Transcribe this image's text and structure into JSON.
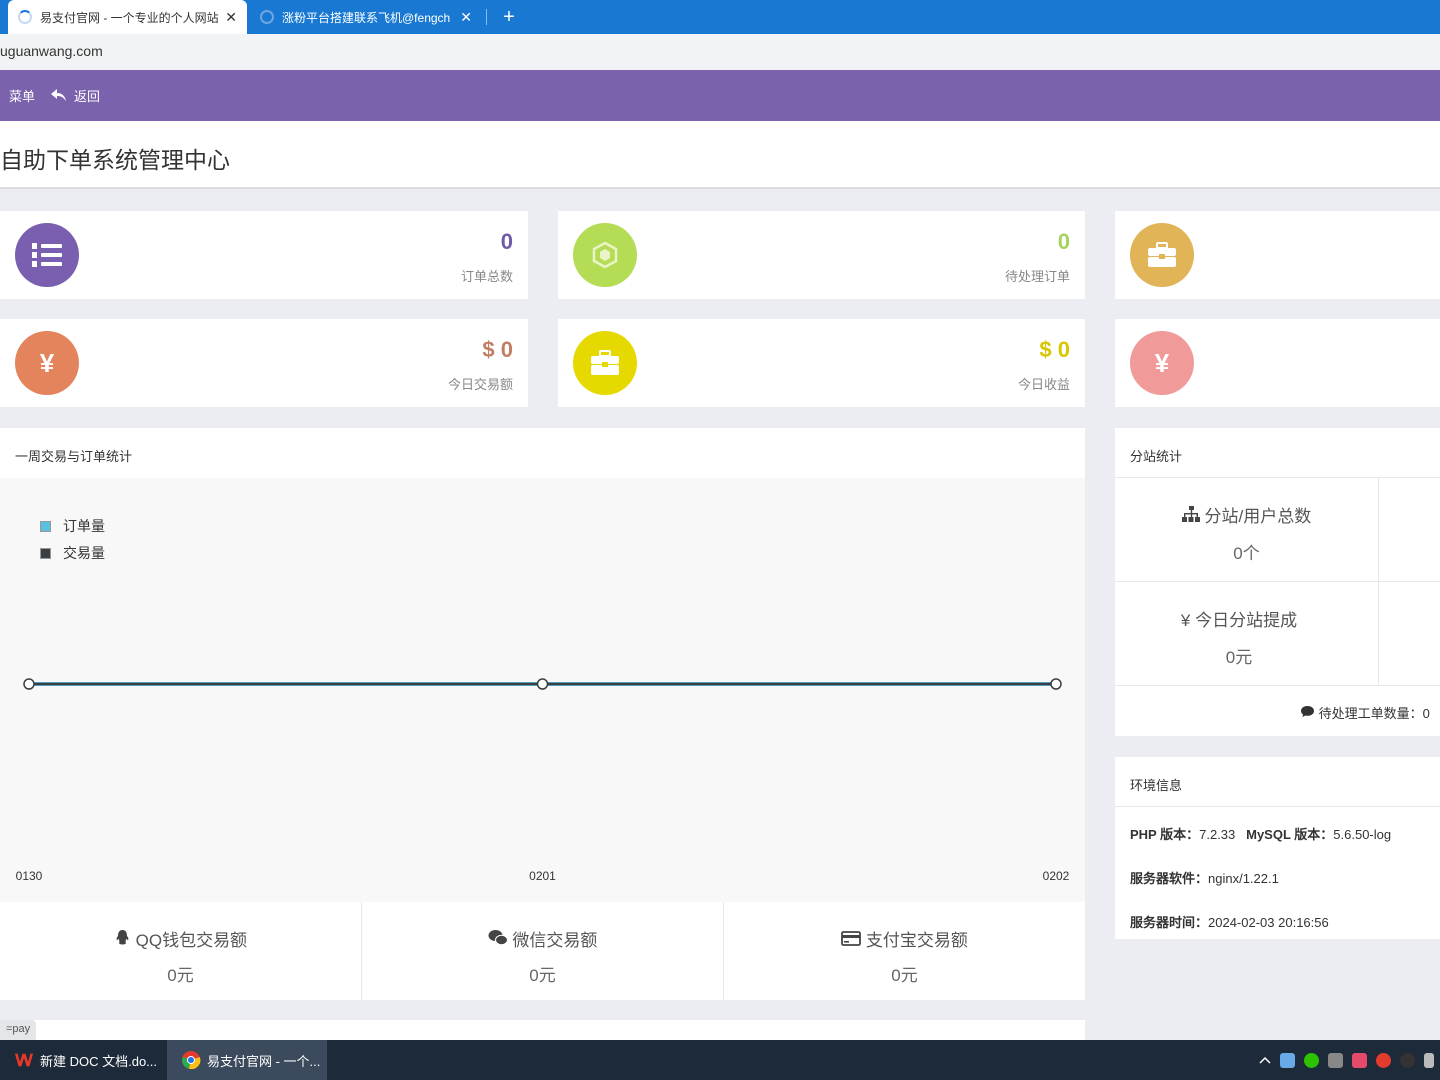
{
  "browser": {
    "tabs": [
      {
        "title": "易支付官网 - 一个专业的个人网站",
        "close": "✕"
      },
      {
        "title": "涨粉平台搭建联系飞机@fengch",
        "close": "✕"
      }
    ],
    "new_tab": "+",
    "url": "uguanwang.com"
  },
  "appbar": {
    "menu_label": "菜单",
    "back_label": "返回"
  },
  "page_title": "自助下单系统管理中心",
  "stats": [
    {
      "value": "0",
      "label": "订单总数",
      "color": "#7a5fb0",
      "value_color": "#6e5aa8"
    },
    {
      "value": "0",
      "label": "待处理订单",
      "color": "#b4dc55",
      "value_color": "#a6d25e"
    },
    {
      "value": "",
      "label": "",
      "color": "#e0b457"
    },
    {
      "value": "$ 0",
      "label": "今日交易额",
      "color": "#e4845c",
      "value_color": "#c27e64"
    },
    {
      "value": "$ 0",
      "label": "今日收益",
      "color": "#e6d900",
      "value_color": "#d8c700"
    },
    {
      "value": "",
      "label": "",
      "color": "#f09a9a"
    }
  ],
  "chart_panel": {
    "title": "一周交易与订单统计"
  },
  "chart_data": {
    "type": "line",
    "x": [
      "0130",
      "0201",
      "0202"
    ],
    "series": [
      {
        "name": "订单量",
        "values": [
          0,
          0,
          0
        ],
        "color": "#5bc0de"
      },
      {
        "name": "交易量",
        "values": [
          0,
          0,
          0
        ],
        "color": "#3a3f44"
      }
    ]
  },
  "payments": [
    {
      "title": "QQ钱包交易额",
      "value": "0元"
    },
    {
      "title": "微信交易额",
      "value": "0元"
    },
    {
      "title": "支付宝交易额",
      "value": "0元"
    }
  ],
  "substation": {
    "title": "分站统计",
    "users_title": "分站/用户总数",
    "users_value": "0个",
    "commission_title": "今日分站提成",
    "commission_value": "0元",
    "tickets_label": "待处理工单数量：0"
  },
  "env": {
    "title": "环境信息",
    "php_label": "PHP 版本：",
    "php_value": "7.2.33",
    "mysql_label": "MySQL 版本：",
    "mysql_value": "5.6.50-log",
    "server_label": "服务器软件：",
    "server_value": "nginx/1.22.1",
    "time_label": "服务器时间：",
    "time_value": "2024-02-03 20:16:56"
  },
  "status_url": "=pay",
  "taskbar": {
    "items": [
      {
        "label": "新建 DOC 文档.do..."
      },
      {
        "label": "易支付官网 - 一个..."
      }
    ]
  }
}
